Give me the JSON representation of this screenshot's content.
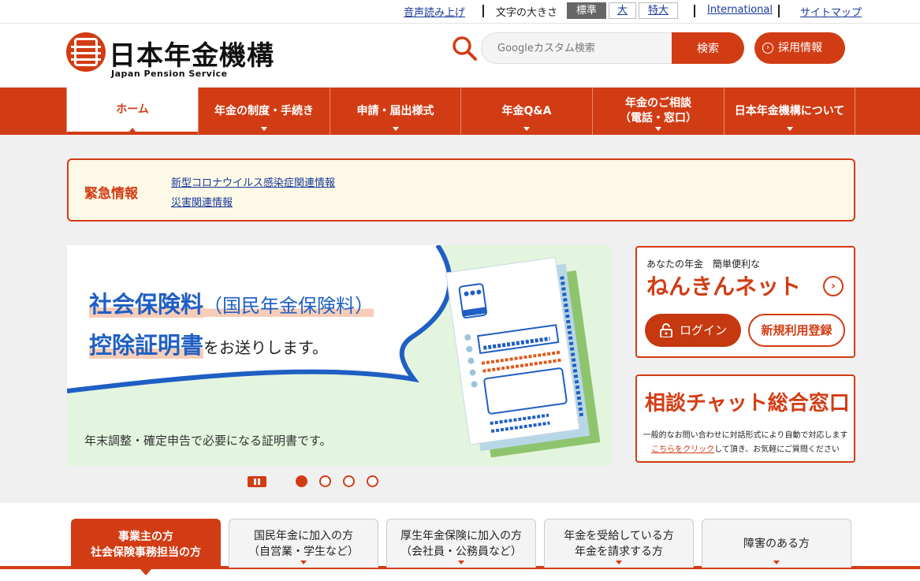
{
  "utility": {
    "voice": "音声読み上げ",
    "font_size_label": "文字の大きさ",
    "font_sizes": [
      "標準",
      "大",
      "特大"
    ],
    "international": "International",
    "sitemap": "サイトマップ"
  },
  "header": {
    "title": "日本年金機構",
    "subtitle": "Japan Pension Service",
    "search_placeholder": "Googleカスタム検索",
    "search_button": "検索",
    "recruit": "採用情報"
  },
  "nav": {
    "items": [
      {
        "label": "ホーム",
        "active": true
      },
      {
        "label": "年金の制度・手続き"
      },
      {
        "label": "申請・届出様式"
      },
      {
        "label": "年金Q&A"
      },
      {
        "label": "年金のご相談\n（電話・窓口）"
      },
      {
        "label": "日本年金機構について"
      }
    ]
  },
  "emergency": {
    "title": "緊急情報",
    "links": [
      "新型コロナウイルス感染症関連情報",
      "災害関連情報"
    ]
  },
  "banner": {
    "line1_main": "社会保険料",
    "line1_paren": "（国民年金保険料）",
    "line2_main": "控除証明書",
    "line2_tail": "をお送りします。",
    "note": "年末調整・確定申告で必要になる証明書です。",
    "slides": 4,
    "current_slide": 1
  },
  "nenkin_net": {
    "tag": "あなたの年金　簡単便利な",
    "title": "ねんきんネット",
    "login": "ログイン",
    "register": "新規利用登録"
  },
  "chat": {
    "title": "相談チャット総合窓口",
    "desc1": "一般的なお問い合わせに対話形式により自動で対応します",
    "link": "こちらをクリック",
    "desc2_rest": "して頂き、お気軽にご質問ください"
  },
  "audience_tabs": [
    {
      "label": "事業主の方\n社会保険事務担当の方",
      "active": true
    },
    {
      "label": "国民年金に加入の方\n（自営業・学生など）"
    },
    {
      "label": "厚生年金保険に加入の方\n（会社員・公務員など）"
    },
    {
      "label": "年金を受給している方\n年金を請求する方"
    },
    {
      "label": "障害のある方"
    }
  ],
  "colors": {
    "brand": "#d23c14",
    "link": "#1a3a9a",
    "banner_text": "#1f5fc4",
    "emergency_bg": "#fcf9e6",
    "banner_bg": "#e3f5de"
  }
}
